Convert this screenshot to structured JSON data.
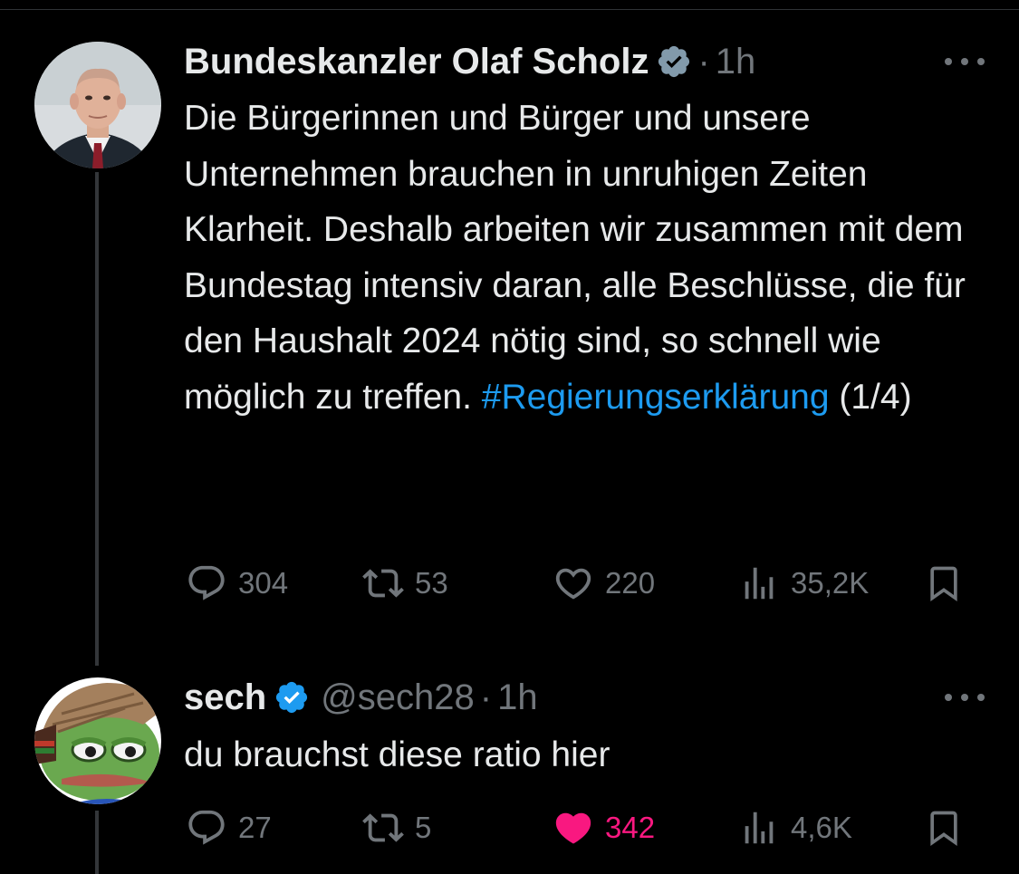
{
  "tweet1": {
    "author_name": "Bundeskanzler Olaf Scholz",
    "verified_icon": "verified-badge-gray-icon",
    "dot": "·",
    "time": "1h",
    "text_before_hashtag": "Die Bürgerinnen und Bürger und unsere Unternehmen brauchen in unruhigen Zeiten Klarheit. Deshalb arbeiten wir zusammen mit dem Bundestag intensiv daran, alle Beschlüsse, die für den Haushalt 2024 nötig sind, so schnell wie möglich zu treffen. ",
    "hashtag": "#Regierungserklärung",
    "text_after_hashtag": " (1/4)",
    "replies": "304",
    "reposts": "53",
    "likes": "220",
    "views": "35,2K"
  },
  "tweet2": {
    "author_name": "sech",
    "verified_icon": "verified-badge-blue-icon",
    "handle": "@sech28",
    "dot": "·",
    "time": "1h",
    "text": "du brauchst diese ratio hier",
    "replies": "27",
    "reposts": "5",
    "likes": "342",
    "views": "4,6K",
    "liked": true
  },
  "colors": {
    "background": "#000000",
    "text": "#e7e9ea",
    "muted": "#71767b",
    "hashtag": "#1d9bf0",
    "like_active": "#f91880",
    "verified_blue": "#1d9bf0",
    "verified_gray": "#829aab"
  }
}
